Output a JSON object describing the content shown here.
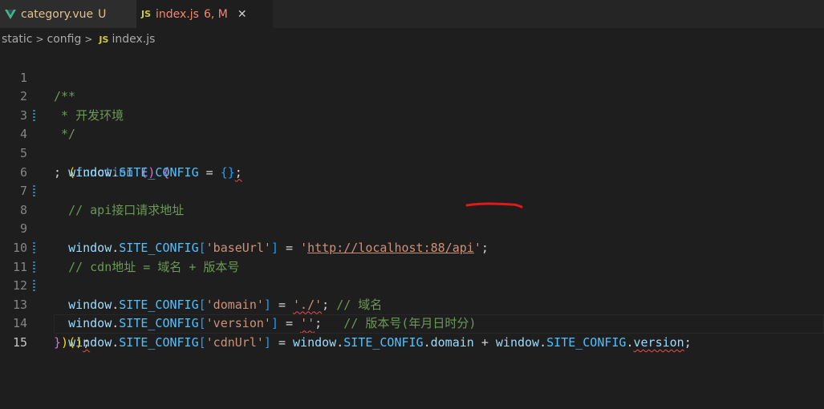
{
  "tabs": [
    {
      "label": "category.vue",
      "status": "U",
      "icon": "vue-icon"
    },
    {
      "label": "index.js",
      "status": "6, M",
      "icon": "js-icon",
      "icon_text": "JS"
    }
  ],
  "breadcrumb": {
    "items": [
      "static",
      "config"
    ],
    "file_icon": "JS",
    "file": "index.js"
  },
  "editor": {
    "lines": [
      {
        "num": "1",
        "c1": "/**"
      },
      {
        "num": "2",
        "c1": " * 开发环境"
      },
      {
        "num": "3",
        "c1": " */"
      },
      {
        "num": "4",
        "semi": "; ",
        "open_paren": "(",
        "kw": "function",
        "sp": " ",
        "params": "()",
        "sp2": " ",
        "brace": "{"
      },
      {
        "num": "5",
        "win": "window",
        "dot": ".",
        "prop": "SITE_CONFIG",
        "eq": " = ",
        "obj": "{}",
        "semi": ";"
      },
      {
        "num": "6"
      },
      {
        "num": "7",
        "comment": "// api接口请求地址"
      },
      {
        "num": "8",
        "win": "window",
        "dot": ".",
        "prop": "SITE_CONFIG",
        "lb": "[",
        "key": "'baseUrl'",
        "rb": "]",
        "eq": " = ",
        "q1": "'",
        "url": "http://localhost:88/api",
        "q2": "'",
        "semi": ";"
      },
      {
        "num": "9"
      },
      {
        "num": "10",
        "comment": "// cdn地址 = 域名 + 版本号"
      },
      {
        "num": "11",
        "win": "window",
        "dot": ".",
        "prop": "SITE_CONFIG",
        "lb": "[",
        "key": "'domain'",
        "rb": "]",
        "eq": " = ",
        "val": "'./'",
        "semi": ";",
        "comment": " // 域名"
      },
      {
        "num": "12",
        "win": "window",
        "dot": ".",
        "prop": "SITE_CONFIG",
        "lb": "[",
        "key": "'version'",
        "rb": "]",
        "eq": " = ",
        "val": "''",
        "semi": ";",
        "comment": "   // 版本号(年月日时分)"
      },
      {
        "num": "13",
        "win": "window",
        "dot": ".",
        "prop": "SITE_CONFIG",
        "lb": "[",
        "key": "'cdnUrl'",
        "rb": "]",
        "eq": " = ",
        "win2": "window",
        "dot2": ".",
        "prop2": "SITE_CONFIG",
        "dot3": ".",
        "p_domain": "domain",
        "plus": " + ",
        "win3": "window",
        "dot4": ".",
        "prop3": "SITE_CONFIG",
        "dot5": ".",
        "p_version": "version",
        "semi": ";"
      },
      {
        "num": "14",
        "close_brace": "}",
        "close_paren": ")",
        "call": "()",
        "semi": ";"
      },
      {
        "num": "15"
      }
    ]
  },
  "colors": {
    "annotation": "#e0191b"
  }
}
